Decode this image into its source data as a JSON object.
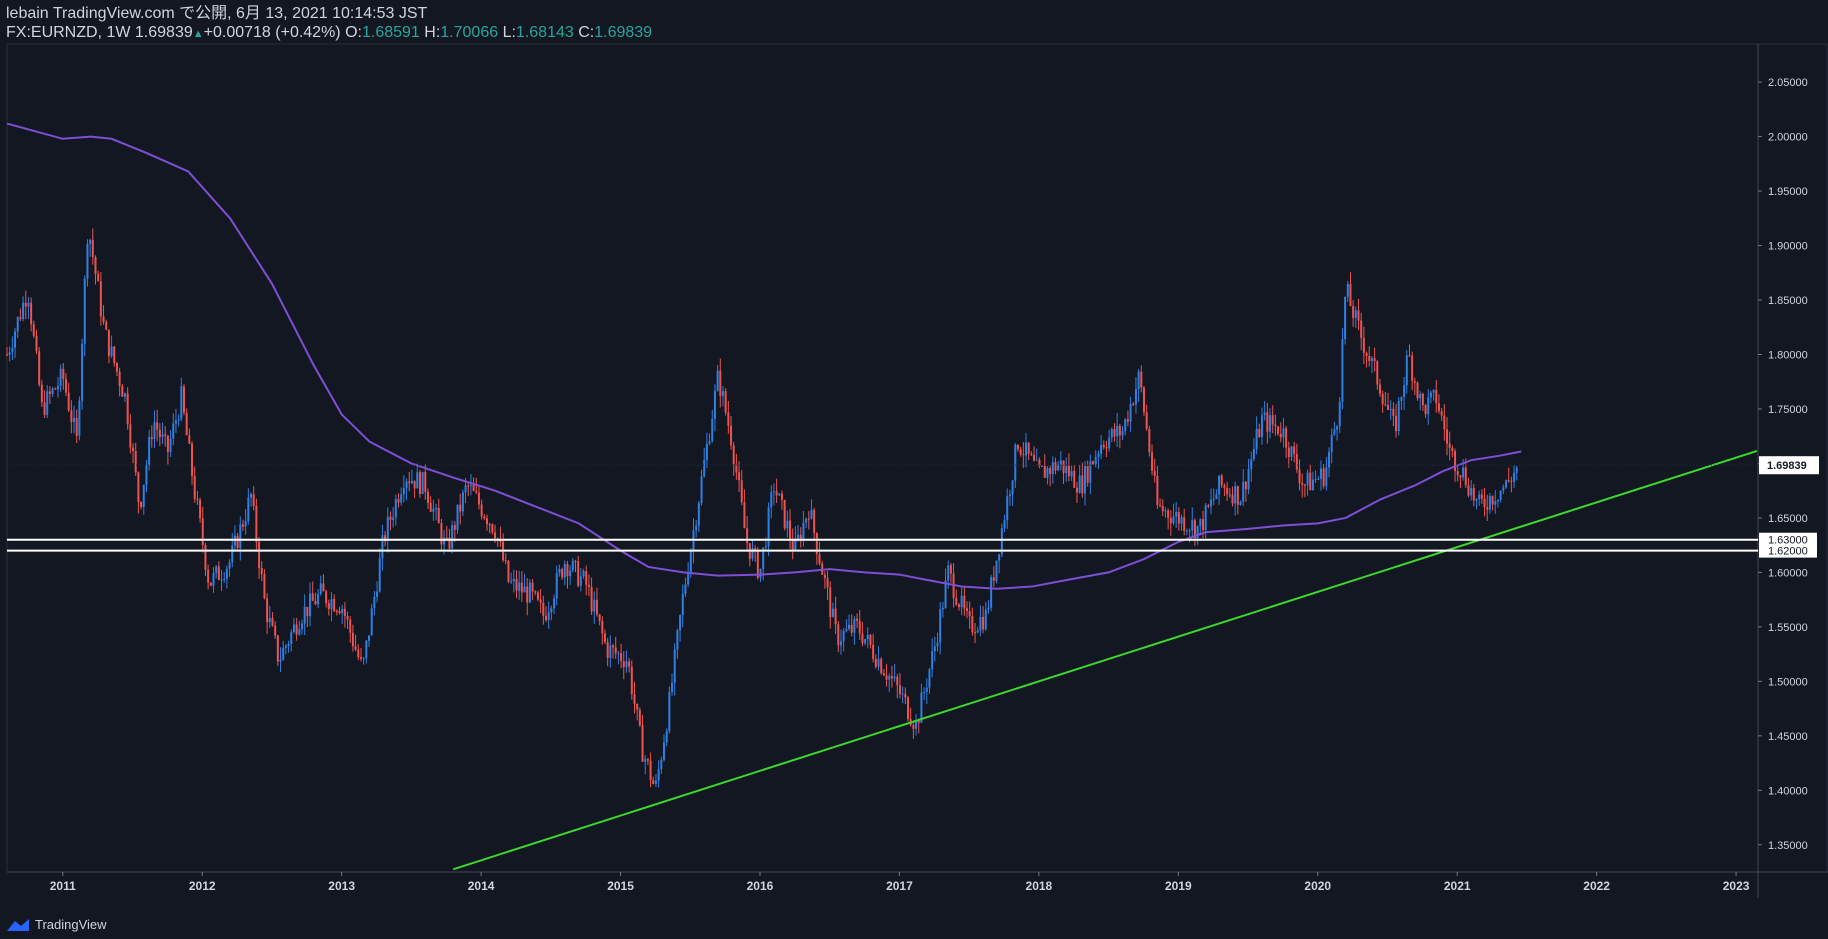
{
  "header": {
    "line1": "lebain TradingView.com で公開, 6月 13, 2021 10:14:53 JST",
    "symbol": "FX:EURNZD, 1W",
    "last": "1.69839",
    "change": "+0.00718 (+0.42%)",
    "o_label": "O:",
    "o_value": "1.68591",
    "h_label": "H:",
    "h_value": "1.70066",
    "l_label": "L:",
    "l_value": "1.68143",
    "c_label": "C:",
    "c_value": "1.69839"
  },
  "footer": {
    "brand": "TradingView"
  },
  "colors": {
    "background": "#131722",
    "up": "#2f80e3",
    "down": "#ef5350",
    "ma": "#7e4fd6",
    "trendline": "#3bd92b",
    "hline": "#ffffff",
    "axis_text": "#d1d4dc",
    "last_price_label_bg": "#ffffff"
  },
  "chart_data": {
    "type": "candlestick",
    "timeframe": "1W",
    "x_ticks": [
      "2011",
      "2012",
      "2013",
      "2014",
      "2015",
      "2016",
      "2017",
      "2018",
      "2019",
      "2020",
      "2021",
      "2022",
      "2023"
    ],
    "y_ticks": [
      "1.35000",
      "1.40000",
      "1.45000",
      "1.50000",
      "1.55000",
      "1.60000",
      "1.65000",
      "1.70000",
      "1.75000",
      "1.80000",
      "1.85000",
      "1.90000",
      "1.95000",
      "2.00000",
      "2.05000"
    ],
    "ylim": [
      1.325,
      2.085
    ],
    "xlim": [
      2010.6,
      2023.15
    ],
    "price_path": [
      [
        2010.6,
        1.8
      ],
      [
        2010.75,
        1.86
      ],
      [
        2010.85,
        1.75
      ],
      [
        2011.0,
        1.78
      ],
      [
        2011.1,
        1.72
      ],
      [
        2011.18,
        1.92
      ],
      [
        2011.3,
        1.82
      ],
      [
        2011.45,
        1.76
      ],
      [
        2011.55,
        1.66
      ],
      [
        2011.65,
        1.74
      ],
      [
        2011.75,
        1.71
      ],
      [
        2011.85,
        1.76
      ],
      [
        2011.95,
        1.67
      ],
      [
        2012.05,
        1.59
      ],
      [
        2012.2,
        1.61
      ],
      [
        2012.35,
        1.67
      ],
      [
        2012.45,
        1.57
      ],
      [
        2012.55,
        1.52
      ],
      [
        2012.7,
        1.56
      ],
      [
        2012.85,
        1.58
      ],
      [
        2013.0,
        1.57
      ],
      [
        2013.15,
        1.51
      ],
      [
        2013.3,
        1.63
      ],
      [
        2013.45,
        1.69
      ],
      [
        2013.6,
        1.68
      ],
      [
        2013.75,
        1.62
      ],
      [
        2013.9,
        1.68
      ],
      [
        2014.1,
        1.64
      ],
      [
        2014.2,
        1.59
      ],
      [
        2014.35,
        1.58
      ],
      [
        2014.45,
        1.56
      ],
      [
        2014.6,
        1.61
      ],
      [
        2014.75,
        1.59
      ],
      [
        2014.9,
        1.53
      ],
      [
        2015.05,
        1.52
      ],
      [
        2015.15,
        1.44
      ],
      [
        2015.25,
        1.4
      ],
      [
        2015.35,
        1.48
      ],
      [
        2015.45,
        1.58
      ],
      [
        2015.55,
        1.66
      ],
      [
        2015.7,
        1.78
      ],
      [
        2015.8,
        1.72
      ],
      [
        2015.9,
        1.63
      ],
      [
        2016.0,
        1.6
      ],
      [
        2016.1,
        1.68
      ],
      [
        2016.25,
        1.62
      ],
      [
        2016.35,
        1.66
      ],
      [
        2016.45,
        1.6
      ],
      [
        2016.55,
        1.54
      ],
      [
        2016.7,
        1.55
      ],
      [
        2016.85,
        1.52
      ],
      [
        2017.0,
        1.49
      ],
      [
        2017.12,
        1.46
      ],
      [
        2017.25,
        1.53
      ],
      [
        2017.35,
        1.6
      ],
      [
        2017.5,
        1.55
      ],
      [
        2017.62,
        1.56
      ],
      [
        2017.72,
        1.63
      ],
      [
        2017.85,
        1.72
      ],
      [
        2018.0,
        1.69
      ],
      [
        2018.15,
        1.7
      ],
      [
        2018.3,
        1.68
      ],
      [
        2018.45,
        1.72
      ],
      [
        2018.6,
        1.73
      ],
      [
        2018.72,
        1.78
      ],
      [
        2018.85,
        1.66
      ],
      [
        2019.0,
        1.65
      ],
      [
        2019.15,
        1.64
      ],
      [
        2019.3,
        1.68
      ],
      [
        2019.45,
        1.67
      ],
      [
        2019.6,
        1.74
      ],
      [
        2019.75,
        1.73
      ],
      [
        2019.9,
        1.68
      ],
      [
        2020.05,
        1.69
      ],
      [
        2020.15,
        1.75
      ],
      [
        2020.2,
        1.86
      ],
      [
        2020.3,
        1.82
      ],
      [
        2020.45,
        1.77
      ],
      [
        2020.55,
        1.73
      ],
      [
        2020.65,
        1.8
      ],
      [
        2020.75,
        1.75
      ],
      [
        2020.85,
        1.76
      ],
      [
        2020.95,
        1.71
      ],
      [
        2021.05,
        1.69
      ],
      [
        2021.15,
        1.66
      ],
      [
        2021.25,
        1.67
      ],
      [
        2021.35,
        1.68
      ],
      [
        2021.44,
        1.698
      ]
    ],
    "moving_average": [
      [
        2010.6,
        2.012
      ],
      [
        2010.8,
        2.005
      ],
      [
        2011.0,
        1.998
      ],
      [
        2011.2,
        2.0
      ],
      [
        2011.35,
        1.998
      ],
      [
        2011.6,
        1.985
      ],
      [
        2011.9,
        1.968
      ],
      [
        2012.2,
        1.925
      ],
      [
        2012.5,
        1.865
      ],
      [
        2012.8,
        1.79
      ],
      [
        2013.0,
        1.745
      ],
      [
        2013.2,
        1.72
      ],
      [
        2013.5,
        1.7
      ],
      [
        2013.8,
        1.687
      ],
      [
        2014.1,
        1.675
      ],
      [
        2014.4,
        1.66
      ],
      [
        2014.7,
        1.645
      ],
      [
        2015.0,
        1.62
      ],
      [
        2015.2,
        1.605
      ],
      [
        2015.45,
        1.6
      ],
      [
        2015.7,
        1.597
      ],
      [
        2016.0,
        1.598
      ],
      [
        2016.25,
        1.6
      ],
      [
        2016.5,
        1.603
      ],
      [
        2016.75,
        1.6
      ],
      [
        2017.0,
        1.598
      ],
      [
        2017.2,
        1.593
      ],
      [
        2017.45,
        1.587
      ],
      [
        2017.7,
        1.585
      ],
      [
        2017.95,
        1.587
      ],
      [
        2018.2,
        1.593
      ],
      [
        2018.5,
        1.6
      ],
      [
        2018.75,
        1.612
      ],
      [
        2019.0,
        1.628
      ],
      [
        2019.2,
        1.637
      ],
      [
        2019.5,
        1.64
      ],
      [
        2019.75,
        1.643
      ],
      [
        2020.0,
        1.645
      ],
      [
        2020.2,
        1.65
      ],
      [
        2020.45,
        1.667
      ],
      [
        2020.7,
        1.68
      ],
      [
        2020.9,
        1.693
      ],
      [
        2021.1,
        1.703
      ],
      [
        2021.3,
        1.707
      ],
      [
        2021.46,
        1.711
      ]
    ],
    "horizontal_lines": [
      {
        "price": 1.63,
        "label": "1.63000"
      },
      {
        "price": 1.62,
        "label": "1.62000"
      }
    ],
    "trendline": {
      "start": [
        2013.8,
        1.3275
      ],
      "end": [
        2023.15,
        1.7115
      ]
    },
    "last_price": {
      "price": 1.69839,
      "label": "1.69839"
    }
  }
}
